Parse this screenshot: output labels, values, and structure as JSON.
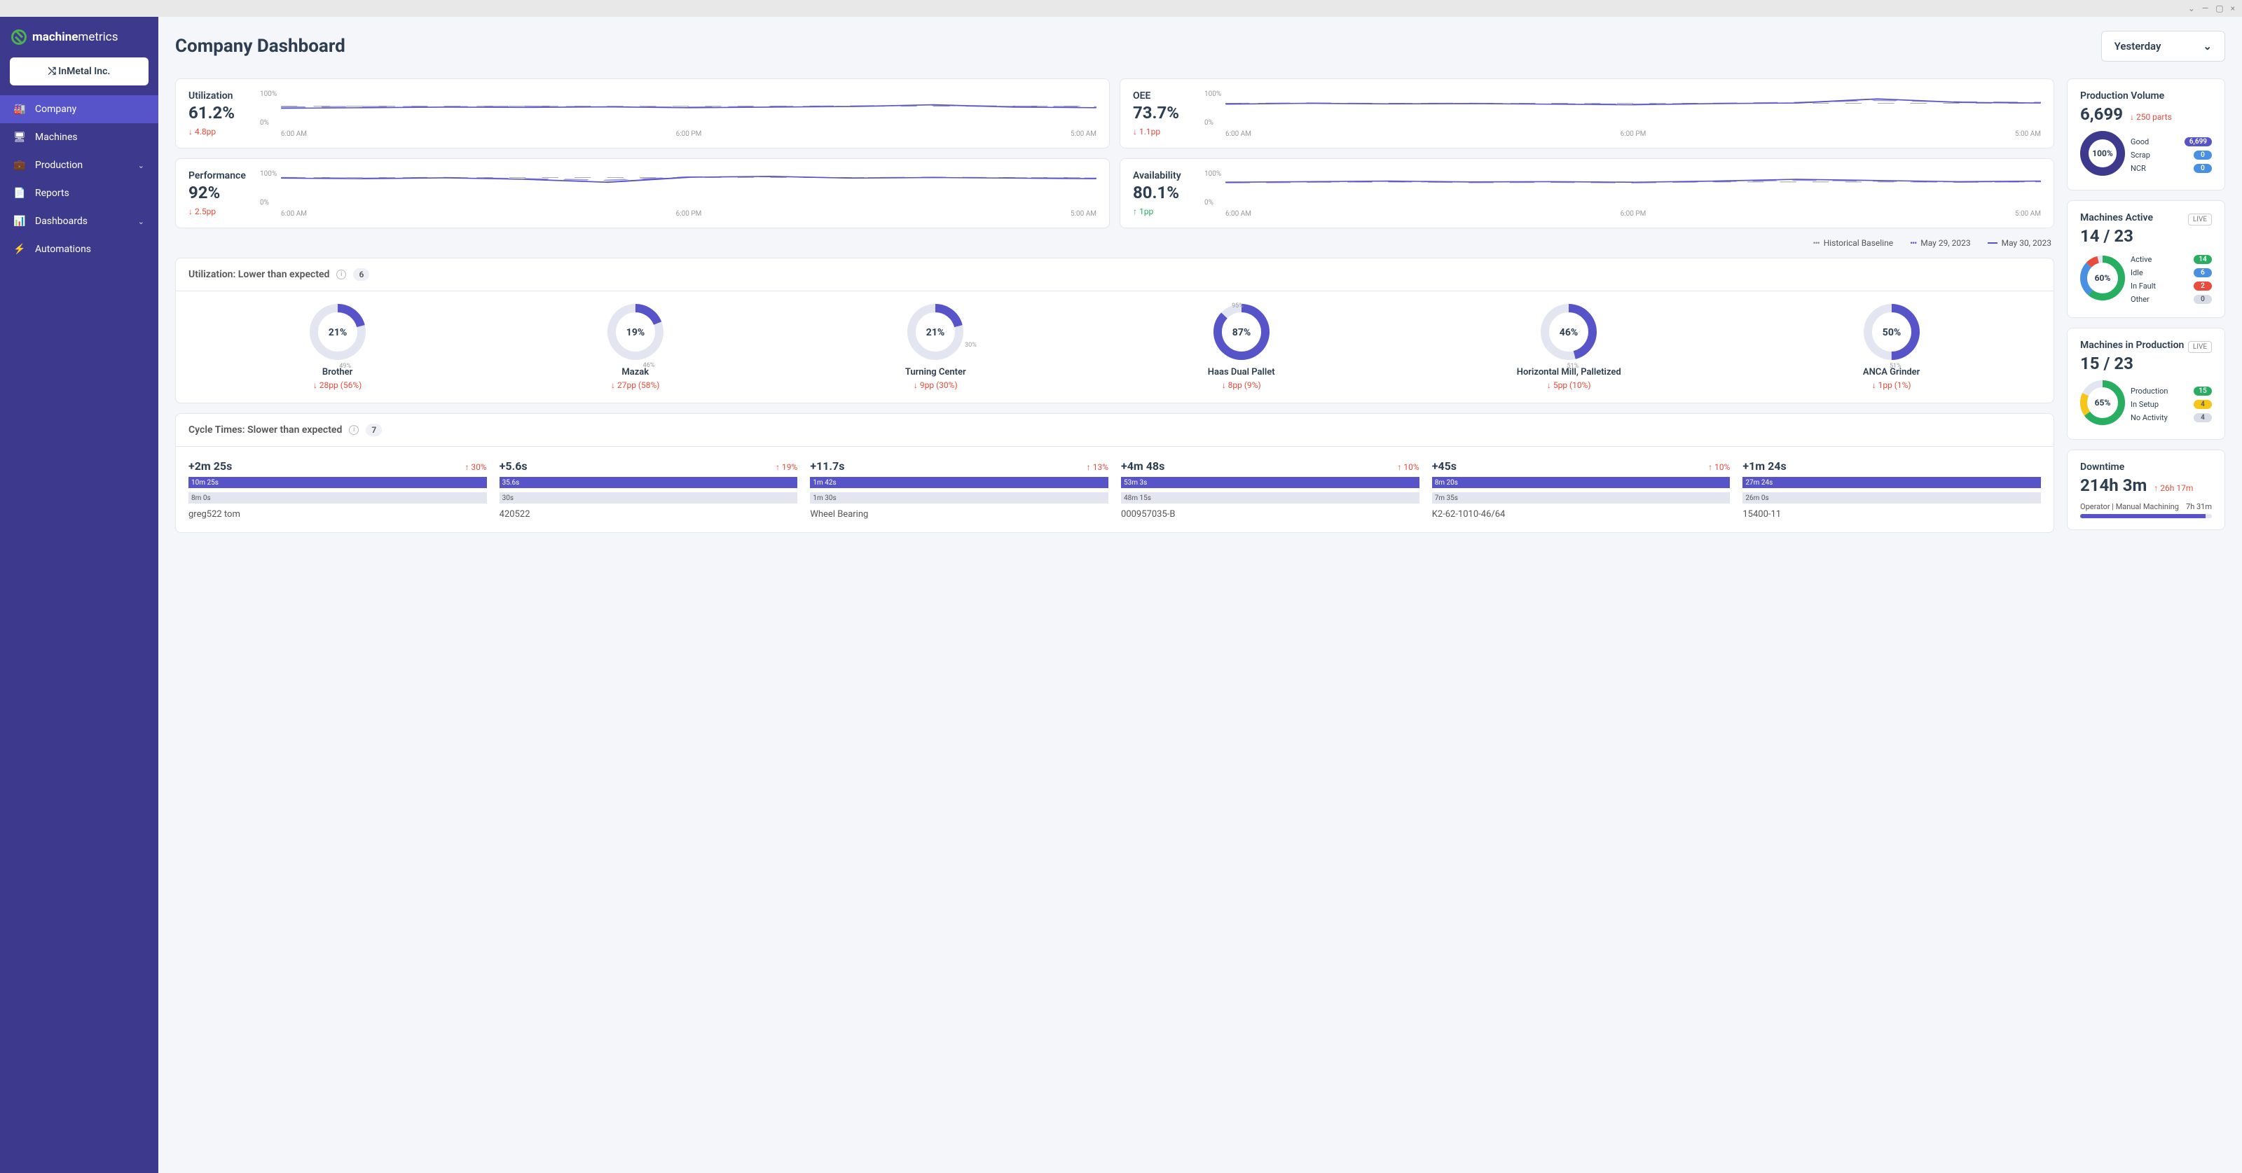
{
  "window_controls": {
    "minimize": "—",
    "maximize": "▢",
    "close": "×",
    "menu": "⌄"
  },
  "brand": {
    "name_bold": "machine",
    "name_light": "metrics"
  },
  "company_selector": {
    "label": "InMetal Inc.",
    "icon": "shuffle"
  },
  "nav": [
    {
      "label": "Company",
      "icon": "factory",
      "active": true
    },
    {
      "label": "Machines",
      "icon": "machine"
    },
    {
      "label": "Production",
      "icon": "briefcase",
      "expandable": true
    },
    {
      "label": "Reports",
      "icon": "document"
    },
    {
      "label": "Dashboards",
      "icon": "bars",
      "expandable": true
    },
    {
      "label": "Automations",
      "icon": "bolt"
    }
  ],
  "page_title": "Company Dashboard",
  "date_filter": {
    "label": "Yesterday"
  },
  "metrics": {
    "utilization": {
      "label": "Utilization",
      "value": "61.2%",
      "delta": "4.8pp",
      "direction": "down"
    },
    "oee": {
      "label": "OEE",
      "value": "73.7%",
      "delta": "1.1pp",
      "direction": "down"
    },
    "performance": {
      "label": "Performance",
      "value": "92%",
      "delta": "2.5pp",
      "direction": "down"
    },
    "availability": {
      "label": "Availability",
      "value": "80.1%",
      "delta": "1pp",
      "direction": "up"
    }
  },
  "chart_axes": {
    "y_top": "100%",
    "y_bot": "0%",
    "x": [
      "6:00 AM",
      "6:00 PM",
      "5:00 AM"
    ]
  },
  "chart_data": [
    {
      "type": "line",
      "title": "Utilization",
      "ylim": [
        0,
        100
      ],
      "x": [
        "6:00 AM",
        "6:00 PM",
        "5:00 AM"
      ],
      "series": [
        {
          "name": "May 30, 2023",
          "values": [
            58,
            60,
            62,
            61,
            63,
            60,
            62,
            64,
            70,
            62,
            60
          ]
        },
        {
          "name": "May 29, 2023",
          "values": [
            62,
            64,
            63,
            65,
            63,
            62,
            64,
            66,
            68,
            65,
            63
          ]
        },
        {
          "name": "Historical Baseline",
          "values": [
            65,
            65,
            65,
            65,
            65,
            65,
            65,
            65,
            65,
            65,
            65
          ]
        }
      ]
    },
    {
      "type": "line",
      "title": "OEE",
      "ylim": [
        0,
        100
      ],
      "x": [
        "6:00 AM",
        "6:00 PM",
        "5:00 AM"
      ],
      "series": [
        {
          "name": "May 30, 2023",
          "values": [
            72,
            75,
            73,
            74,
            72,
            70,
            74,
            76,
            90,
            78,
            76
          ]
        },
        {
          "name": "May 29, 2023",
          "values": [
            74,
            76,
            74,
            75,
            73,
            72,
            75,
            78,
            85,
            80,
            78
          ]
        },
        {
          "name": "Historical Baseline",
          "values": [
            75,
            75,
            75,
            75,
            75,
            75,
            75,
            75,
            75,
            75,
            75
          ]
        }
      ]
    },
    {
      "type": "line",
      "title": "Performance",
      "ylim": [
        0,
        100
      ],
      "x": [
        "6:00 AM",
        "6:00 PM",
        "5:00 AM"
      ],
      "series": [
        {
          "name": "May 30, 2023",
          "values": [
            92,
            90,
            93,
            88,
            78,
            95,
            98,
            92,
            94,
            92,
            90
          ]
        },
        {
          "name": "May 29, 2023",
          "values": [
            94,
            92,
            94,
            90,
            85,
            96,
            97,
            93,
            95,
            93,
            92
          ]
        },
        {
          "name": "Historical Baseline",
          "values": [
            94,
            94,
            94,
            94,
            94,
            94,
            94,
            94,
            94,
            94,
            94
          ]
        }
      ]
    },
    {
      "type": "line",
      "title": "Availability",
      "ylim": [
        0,
        100
      ],
      "x": [
        "6:00 AM",
        "6:00 PM",
        "5:00 AM"
      ],
      "series": [
        {
          "name": "May 30, 2023",
          "values": [
            78,
            80,
            82,
            79,
            80,
            78,
            82,
            88,
            84,
            80,
            82
          ]
        },
        {
          "name": "May 29, 2023",
          "values": [
            76,
            78,
            80,
            77,
            78,
            76,
            80,
            85,
            82,
            78,
            80
          ]
        },
        {
          "name": "Historical Baseline",
          "values": [
            79,
            79,
            79,
            79,
            79,
            79,
            79,
            79,
            79,
            79,
            79
          ]
        }
      ]
    }
  ],
  "legend": {
    "baseline": "Historical Baseline",
    "prev": "May 29, 2023",
    "curr": "May 30, 2023"
  },
  "util_panel": {
    "title": "Utilization: Lower than expected",
    "count": "6",
    "items": [
      {
        "pct": 21,
        "target": 49,
        "name": "Brother",
        "delta": "28pp (56%)"
      },
      {
        "pct": 19,
        "target": 46,
        "name": "Mazak",
        "delta": "27pp (58%)"
      },
      {
        "pct": 21,
        "target": 30,
        "name": "Turning Center",
        "delta": "9pp (30%)"
      },
      {
        "pct": 87,
        "target": 95,
        "name": "Haas Dual Pallet",
        "delta": "8pp (9%)"
      },
      {
        "pct": 46,
        "target": 51,
        "name": "Horizontal Mill, Palletized",
        "delta": "5pp (10%)"
      },
      {
        "pct": 50,
        "target": 51,
        "name": "ANCA Grinder",
        "delta": "1pp (1%)"
      }
    ]
  },
  "cycle_panel": {
    "title": "Cycle Times: Slower than expected",
    "count": "7",
    "items": [
      {
        "delta_val": "+2m 25s",
        "pct": "30%",
        "bar1": "10m 25s",
        "bar2": "8m 0s",
        "name": "greg522 tom"
      },
      {
        "delta_val": "+5.6s",
        "pct": "19%",
        "bar1": "35.6s",
        "bar2": "30s",
        "name": "420522"
      },
      {
        "delta_val": "+11.7s",
        "pct": "13%",
        "bar1": "1m 42s",
        "bar2": "1m 30s",
        "name": "Wheel Bearing"
      },
      {
        "delta_val": "+4m 48s",
        "pct": "10%",
        "bar1": "53m 3s",
        "bar2": "48m 15s",
        "name": "000957035-B"
      },
      {
        "delta_val": "+45s",
        "pct": "10%",
        "bar1": "8m 20s",
        "bar2": "7m 35s",
        "name": "K2-62-1010-46/64"
      },
      {
        "delta_val": "+1m 24s",
        "pct": "",
        "bar1": "27m 24s",
        "bar2": "26m 0s",
        "name": "15400-11"
      }
    ]
  },
  "side": {
    "production_volume": {
      "title": "Production Volume",
      "value": "6,699",
      "delta": "250 parts",
      "donut_pct": "100%",
      "legend": [
        {
          "label": "Good",
          "value": "6,699",
          "pill": "blue"
        },
        {
          "label": "Scrap",
          "value": "0",
          "pill": "lblue"
        },
        {
          "label": "NCR",
          "value": "0",
          "pill": "lblue"
        }
      ]
    },
    "machines_active": {
      "title": "Machines Active",
      "value": "14 / 23",
      "live": "LIVE",
      "donut_pct": "60%",
      "legend": [
        {
          "label": "Active",
          "value": "14",
          "pill": "green"
        },
        {
          "label": "Idle",
          "value": "6",
          "pill": "lblue"
        },
        {
          "label": "In Fault",
          "value": "2",
          "pill": "red"
        },
        {
          "label": "Other",
          "value": "0",
          "pill": "gray"
        }
      ]
    },
    "machines_production": {
      "title": "Machines in Production",
      "value": "15 / 23",
      "live": "LIVE",
      "donut_pct": "65%",
      "legend": [
        {
          "label": "Production",
          "value": "15",
          "pill": "green"
        },
        {
          "label": "In Setup",
          "value": "4",
          "pill": "yellow"
        },
        {
          "label": "No Activity",
          "value": "4",
          "pill": "gray"
        }
      ]
    },
    "downtime": {
      "title": "Downtime",
      "value": "214h 3m",
      "delta": "26h 17m",
      "rows": [
        {
          "label": "Operator | Manual Machining",
          "value": "7h 31m",
          "pct": 95
        }
      ]
    }
  }
}
